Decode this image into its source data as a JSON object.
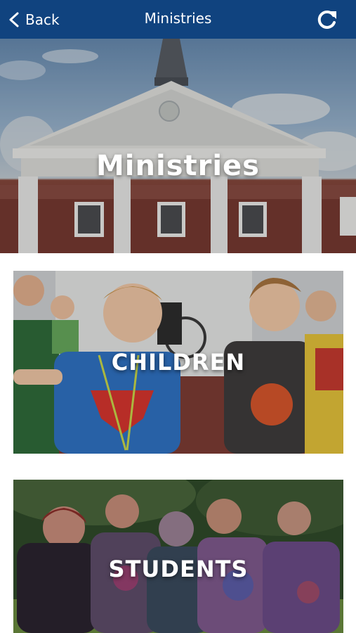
{
  "nav": {
    "back_label": "Back",
    "title": "Ministries",
    "back_icon": "chevron-left-icon",
    "refresh_icon": "refresh-icon",
    "bar_color": "#10437f"
  },
  "hero": {
    "title": "Ministries"
  },
  "cards": [
    {
      "label": "CHILDREN"
    },
    {
      "label": "STUDENTS"
    }
  ]
}
